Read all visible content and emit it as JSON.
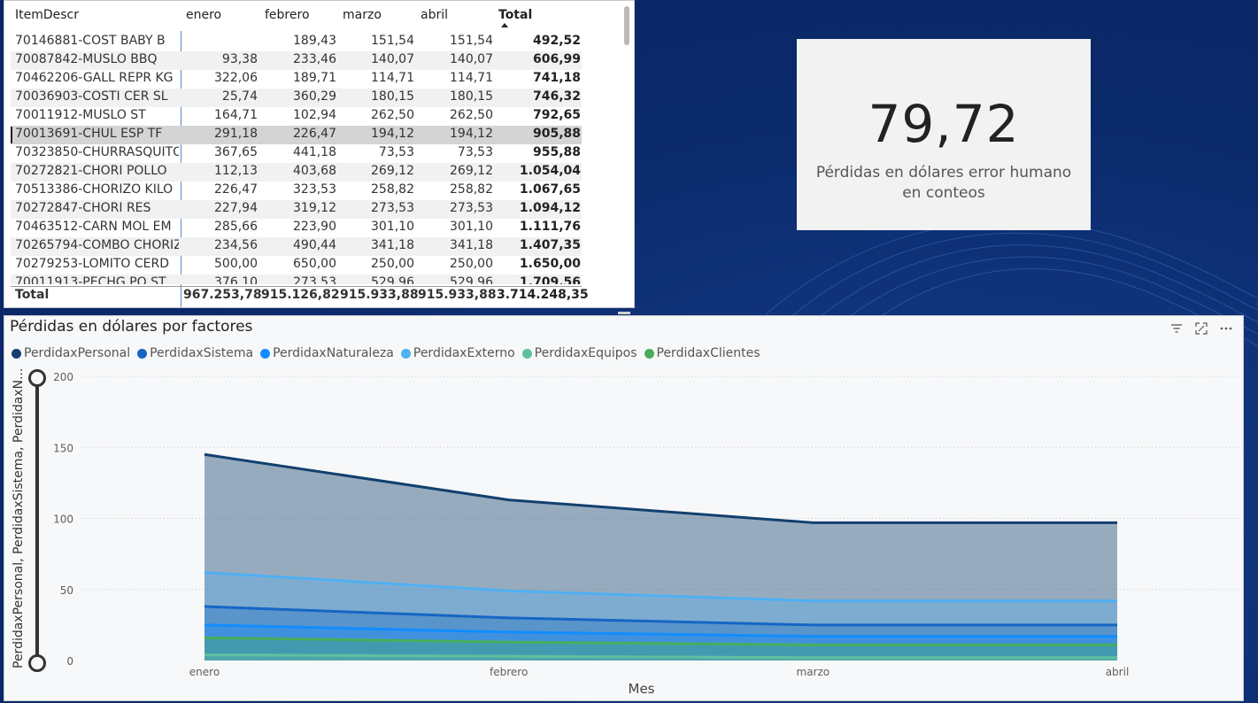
{
  "table": {
    "headers": {
      "desc": "ItemDescr",
      "ene": "enero",
      "feb": "febrero",
      "mar": "marzo",
      "abr": "abril",
      "tot": "Total"
    },
    "rows": [
      {
        "desc": "70146881-COST BABY B",
        "ene": "",
        "feb": "189,43",
        "mar": "151,54",
        "abr": "151,54",
        "tot": "492,52"
      },
      {
        "desc": "70087842-MUSLO BBQ",
        "ene": "93,38",
        "feb": "233,46",
        "mar": "140,07",
        "abr": "140,07",
        "tot": "606,99"
      },
      {
        "desc": "70462206-GALL REPR KG",
        "ene": "322,06",
        "feb": "189,71",
        "mar": "114,71",
        "abr": "114,71",
        "tot": "741,18"
      },
      {
        "desc": "70036903-COSTI CER SL",
        "ene": "25,74",
        "feb": "360,29",
        "mar": "180,15",
        "abr": "180,15",
        "tot": "746,32"
      },
      {
        "desc": "70011912-MUSLO ST",
        "ene": "164,71",
        "feb": "102,94",
        "mar": "262,50",
        "abr": "262,50",
        "tot": "792,65"
      },
      {
        "desc": "70013691-CHUL ESP TF",
        "ene": "291,18",
        "feb": "226,47",
        "mar": "194,12",
        "abr": "194,12",
        "tot": "905,88"
      },
      {
        "desc": "70323850-CHURRASQUITO",
        "ene": "367,65",
        "feb": "441,18",
        "mar": "73,53",
        "abr": "73,53",
        "tot": "955,88"
      },
      {
        "desc": "70272821-CHORI POLLO",
        "ene": "112,13",
        "feb": "403,68",
        "mar": "269,12",
        "abr": "269,12",
        "tot": "1.054,04"
      },
      {
        "desc": "70513386-CHORIZO KILO",
        "ene": "226,47",
        "feb": "323,53",
        "mar": "258,82",
        "abr": "258,82",
        "tot": "1.067,65"
      },
      {
        "desc": "70272847-CHORI RES",
        "ene": "227,94",
        "feb": "319,12",
        "mar": "273,53",
        "abr": "273,53",
        "tot": "1.094,12"
      },
      {
        "desc": "70463512-CARN MOL EM",
        "ene": "285,66",
        "feb": "223,90",
        "mar": "301,10",
        "abr": "301,10",
        "tot": "1.111,76"
      },
      {
        "desc": "70265794-COMBO CHORIZ",
        "ene": "234,56",
        "feb": "490,44",
        "mar": "341,18",
        "abr": "341,18",
        "tot": "1.407,35"
      },
      {
        "desc": "70279253-LOMITO CERD",
        "ene": "500,00",
        "feb": "650,00",
        "mar": "250,00",
        "abr": "250,00",
        "tot": "1.650,00"
      },
      {
        "desc": "70011913-PECHG PO ST",
        "ene": "376,10",
        "feb": "273,53",
        "mar": "529,96",
        "abr": "529,96",
        "tot": "1.709,56"
      }
    ],
    "total": {
      "desc": "Total",
      "ene": "967.253,78",
      "feb": "915.126,82",
      "mar": "915.933,88",
      "abr": "915.933,88",
      "tot": "3.714.248,35"
    }
  },
  "kpi": {
    "value": "79,72",
    "label": "Pérdidas en dólares error humano en conteos"
  },
  "chart": {
    "title": "Pérdidas en dólares por factores",
    "ylabel": "PerdidaxPersonal, PerdidaxSistema, PerdidaxN...",
    "xlabel": "Mes",
    "icons": [
      "filter-icon",
      "focus-mode-icon",
      "more-options-icon"
    ]
  },
  "chart_data": {
    "type": "area",
    "title": "Pérdidas en dólares por factores",
    "xlabel": "Mes",
    "ylabel": "PerdidaxPersonal, PerdidaxSistema, PerdidaxN...",
    "categories": [
      "enero",
      "febrero",
      "marzo",
      "abril"
    ],
    "ylim": [
      0,
      200
    ],
    "yticks": [
      0,
      50,
      100,
      150,
      200
    ],
    "grid": true,
    "legend_position": "top-left",
    "series": [
      {
        "name": "PerdidaxPersonal",
        "color": "#12406f",
        "values": [
          145,
          113,
          97,
          97
        ]
      },
      {
        "name": "PerdidaxSistema",
        "color": "#1566c4",
        "values": [
          38,
          30,
          25,
          25
        ]
      },
      {
        "name": "PerdidaxNaturaleza",
        "color": "#118dff",
        "values": [
          25,
          20,
          17,
          17
        ]
      },
      {
        "name": "PerdidaxExterno",
        "color": "#4fb0f2",
        "values": [
          62,
          49,
          42,
          42
        ]
      },
      {
        "name": "PerdidaxEquipos",
        "color": "#5fbfa0",
        "values": [
          4,
          3,
          2,
          2
        ]
      },
      {
        "name": "PerdidaxClientes",
        "color": "#48ad5c",
        "values": [
          16,
          13,
          11,
          11
        ]
      }
    ]
  }
}
